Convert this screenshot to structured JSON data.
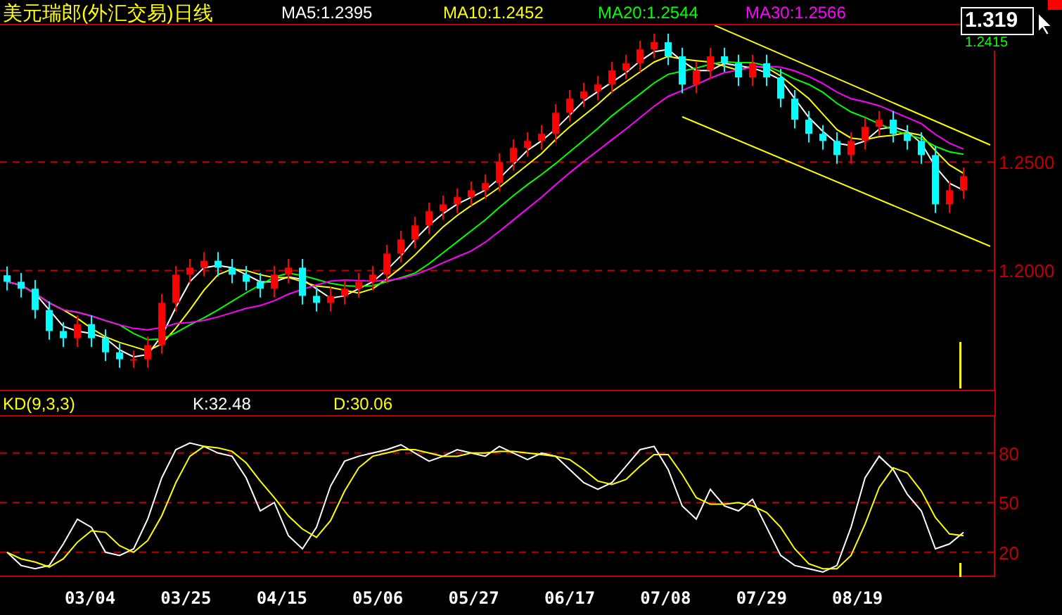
{
  "title": "美元瑞郎(外汇交易)日线",
  "legend": [
    {
      "text": "MA5:1.2395",
      "color": "#ffffff"
    },
    {
      "text": "MA10:1.2452",
      "color": "#ffff00"
    },
    {
      "text": "MA20:1.2544",
      "color": "#00ff00"
    },
    {
      "text": "MA30:1.2566",
      "color": "#ff00ff"
    }
  ],
  "readout": {
    "value": "1.319",
    "secondary": "1.2415"
  },
  "price_axis_labels": [
    "1.2500",
    "1.2000"
  ],
  "kd_header": [
    {
      "text": "KD(9,3,3)",
      "color": "#ffff00"
    },
    {
      "text": "K:32.48",
      "color": "#ffffff"
    },
    {
      "text": "D:30.06",
      "color": "#ffff00"
    }
  ],
  "kd_chart": {
    "chart_data": {
      "type": "line",
      "ylim": [
        5,
        102
      ],
      "yticks": [
        80,
        50,
        20
      ],
      "grid": true,
      "series": [
        {
          "color": "#ffffff",
          "values": [
            20,
            12,
            10,
            12,
            25,
            40,
            35,
            20,
            18,
            22,
            40,
            65,
            82,
            86,
            84,
            80,
            78,
            65,
            45,
            50,
            30,
            22,
            35,
            60,
            75,
            78,
            80,
            82,
            85,
            80,
            75,
            78,
            82,
            80,
            78,
            84,
            80,
            76,
            80,
            78,
            70,
            62,
            58,
            62,
            72,
            82,
            84,
            70,
            48,
            40,
            58,
            48,
            45,
            52,
            35,
            18,
            12,
            10,
            8,
            12,
            35,
            65,
            78,
            70,
            55,
            45,
            22,
            25,
            32
          ]
        },
        {
          "color": "#ffff00",
          "values": [
            20,
            16,
            14,
            11,
            16,
            26,
            33,
            32,
            24,
            20,
            27,
            42,
            62,
            78,
            84,
            83,
            81,
            74,
            63,
            53,
            42,
            34,
            29,
            39,
            57,
            71,
            78,
            80,
            82,
            82,
            80,
            78,
            78,
            80,
            80,
            81,
            81,
            80,
            79,
            78,
            76,
            70,
            63,
            61,
            64,
            72,
            79,
            79,
            67,
            53,
            49,
            49,
            50,
            48,
            44,
            35,
            22,
            13,
            10,
            10,
            18,
            37,
            59,
            71,
            68,
            57,
            41,
            31,
            30
          ]
        }
      ]
    }
  },
  "date_axis": [
    "03/04",
    "03/25",
    "04/15",
    "05/06",
    "05/27",
    "06/17",
    "07/08",
    "07/29",
    "08/19"
  ]
}
